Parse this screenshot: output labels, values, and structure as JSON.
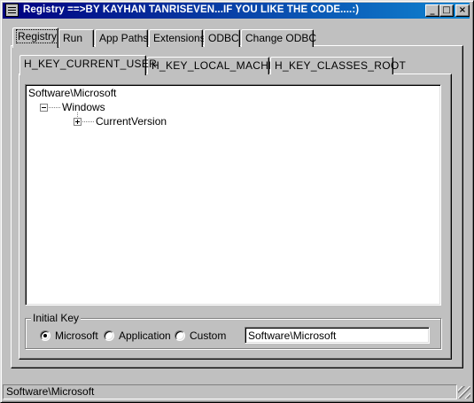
{
  "window": {
    "title": "Registry  ==>BY KAYHAN TANRISEVEN...IF YOU LIKE THE CODE....:)",
    "minimize_glyph": "_",
    "maximize_glyph": "□",
    "close_glyph": "×"
  },
  "main_tabs": [
    {
      "label": "Registry",
      "active": true
    },
    {
      "label": "Run",
      "active": false
    },
    {
      "label": "App Paths",
      "active": false
    },
    {
      "label": "Extensions",
      "active": false
    },
    {
      "label": "ODBC",
      "active": false
    },
    {
      "label": "Change ODBC",
      "active": false
    }
  ],
  "hive_tabs": [
    {
      "label": "H_KEY_CURRENT_USER",
      "active": true
    },
    {
      "label": "H_KEY_LOCAL_MACHINE",
      "active": false
    },
    {
      "label": "H_KEY_CLASSES_ROOT",
      "active": false
    }
  ],
  "tree": {
    "root": "Software\\Microsoft",
    "child": "Windows",
    "grandchild": "CurrentVersion"
  },
  "initial_key": {
    "group_title": "Initial Key",
    "options": [
      {
        "label": "Microsoft",
        "checked": true
      },
      {
        "label": "Application",
        "checked": false
      },
      {
        "label": "Custom",
        "checked": false
      }
    ],
    "value": "Software\\Microsoft"
  },
  "statusbar": {
    "text": "Software\\Microsoft"
  }
}
